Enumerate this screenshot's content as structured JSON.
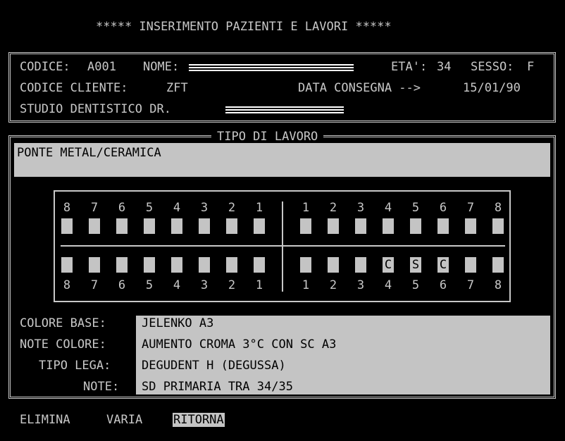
{
  "title": "***** INSERIMENTO PAZIENTI E LAVORI *****",
  "patient": {
    "codice_label": "CODICE:",
    "codice_value": "A001",
    "nome_label": "NOME:",
    "eta_label": "ETA':",
    "eta_value": "34",
    "sesso_label": "SESSO:",
    "sesso_value": "F",
    "codice_cliente_label": "CODICE CLIENTE:",
    "codice_cliente_value": "ZFT",
    "data_consegna_label": "DATA CONSEGNA -->",
    "data_consegna_value": "15/01/90",
    "studio_label": "STUDIO DENTISTICO DR."
  },
  "lavoro": {
    "section_title": "TIPO DI LAVORO",
    "description": "PONTE METAL/CERAMICA"
  },
  "teeth": {
    "left_numbers": [
      "8",
      "7",
      "6",
      "5",
      "4",
      "3",
      "2",
      "1"
    ],
    "right_numbers": [
      "1",
      "2",
      "3",
      "4",
      "5",
      "6",
      "7",
      "8"
    ],
    "upper_left": [
      "",
      "",
      "",
      "",
      "",
      "",
      "",
      ""
    ],
    "upper_right": [
      "",
      "",
      "",
      "",
      "",
      "",
      "",
      ""
    ],
    "lower_left": [
      "",
      "",
      "",
      "",
      "",
      "",
      "",
      ""
    ],
    "lower_right": [
      "",
      "",
      "",
      "C",
      "S",
      "C",
      "",
      ""
    ]
  },
  "fields": [
    {
      "label": "COLORE BASE:",
      "value": "JELENKO A3"
    },
    {
      "label": "NOTE COLORE:",
      "value": "AUMENTO CROMA 3°C CON SC A3"
    },
    {
      "label": "TIPO LEGA:",
      "value": "DEGUDENT H (DEGUSSA)"
    },
    {
      "label": "NOTE:",
      "value": "SD PRIMARIA TRA 34/35"
    }
  ],
  "menu": {
    "elimina": "ELIMINA",
    "varia": "VARIA",
    "ritorna": "RITORNA"
  },
  "colors": {
    "background": "#000000",
    "text": "#c8c8c8",
    "field_bg": "#c4c4c4"
  }
}
